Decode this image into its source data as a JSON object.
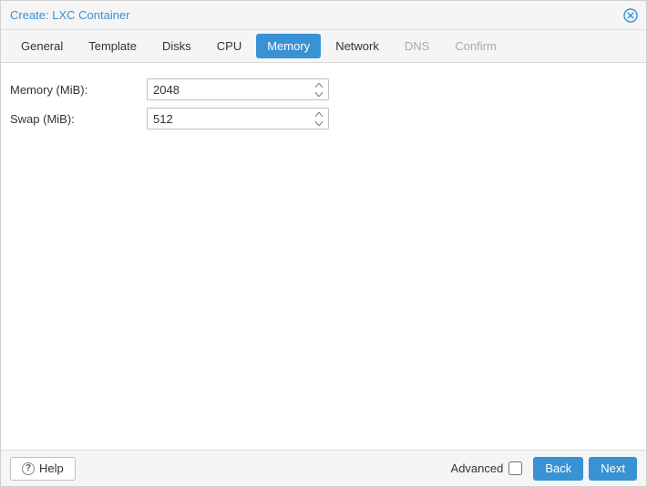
{
  "window": {
    "title": "Create: LXC Container"
  },
  "tabs": [
    {
      "key": "general",
      "label": "General",
      "state": "normal"
    },
    {
      "key": "template",
      "label": "Template",
      "state": "normal"
    },
    {
      "key": "disks",
      "label": "Disks",
      "state": "normal"
    },
    {
      "key": "cpu",
      "label": "CPU",
      "state": "normal"
    },
    {
      "key": "memory",
      "label": "Memory",
      "state": "active"
    },
    {
      "key": "network",
      "label": "Network",
      "state": "normal"
    },
    {
      "key": "dns",
      "label": "DNS",
      "state": "disabled"
    },
    {
      "key": "confirm",
      "label": "Confirm",
      "state": "disabled"
    }
  ],
  "form": {
    "memory": {
      "label": "Memory (MiB):",
      "value": "2048"
    },
    "swap": {
      "label": "Swap (MiB):",
      "value": "512"
    }
  },
  "footer": {
    "help": "Help",
    "advanced_label": "Advanced",
    "advanced_checked": false,
    "back": "Back",
    "next": "Next"
  },
  "icons": {
    "close": "close-icon",
    "spin_up": "chevron-up-icon",
    "spin_down": "chevron-down-icon",
    "help": "help-icon"
  }
}
